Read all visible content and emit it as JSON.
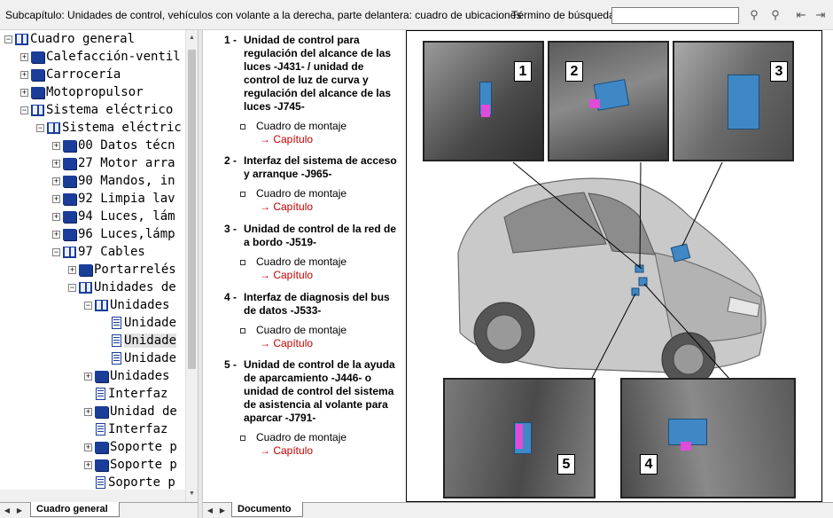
{
  "header": {
    "subchapter": "Subcapítulo: Unidades de control, vehículos con volante a la derecha, parte delantera: cuadro de ubicaciones",
    "search_label": "Término de búsqueda:",
    "search_value": ""
  },
  "tree": {
    "items": [
      {
        "label": "Cuadro general"
      },
      {
        "label": "Calefacción-ventil"
      },
      {
        "label": "Carrocería"
      },
      {
        "label": "Motopropulsor"
      },
      {
        "label": "Sistema eléctrico"
      },
      {
        "label": "Sistema eléctric"
      },
      {
        "label": "00 Datos técn"
      },
      {
        "label": "27 Motor arra"
      },
      {
        "label": "90 Mandos, in"
      },
      {
        "label": "92 Limpia lav"
      },
      {
        "label": "94 Luces, lám"
      },
      {
        "label": "96 Luces,lámp"
      },
      {
        "label": "97 Cables"
      },
      {
        "label": "Portarrelés"
      },
      {
        "label": "Unidades de"
      },
      {
        "label": "Unidades"
      },
      {
        "label": "Unidade"
      },
      {
        "label": "Unidade"
      },
      {
        "label": "Unidade"
      },
      {
        "label": "Unidades"
      },
      {
        "label": "Interfaz"
      },
      {
        "label": "Unidad de"
      },
      {
        "label": "Interfaz"
      },
      {
        "label": "Soporte p"
      },
      {
        "label": "Soporte p"
      },
      {
        "label": "Soporte p"
      }
    ]
  },
  "tabs": {
    "left": "Cuadro general",
    "right": "Documento"
  },
  "document": {
    "items": [
      {
        "num": "1 -",
        "title": "Unidad de control para regulación del alcance de las luces -J431- / unidad de control de luz de curva y regulación del alcance de las luces -J745-",
        "sub": "Cuadro de montaje",
        "link": "→ Capítulo"
      },
      {
        "num": "2 -",
        "title": "Interfaz del sistema de acceso y arranque -J965-",
        "sub": "Cuadro de montaje",
        "link": "→ Capítulo"
      },
      {
        "num": "3 -",
        "title": "Unidad de control de la red de a bordo -J519-",
        "sub": "Cuadro de montaje",
        "link": "→ Capítulo"
      },
      {
        "num": "4 -",
        "title": "Interfaz de diagnosis del bus de datos -J533-",
        "sub": "Cuadro de montaje",
        "link": "→ Capítulo"
      },
      {
        "num": "5 -",
        "title": "Unidad de control de la ayuda de aparcamiento -J446- o unidad de control del sistema de asistencia al volante para aparcar -J791-",
        "sub": "Cuadro de montaje",
        "link": "→ Capítulo"
      }
    ]
  },
  "figure": {
    "callouts": [
      "1",
      "2",
      "3",
      "4",
      "5"
    ]
  },
  "colors": {
    "link": "#c00000",
    "book": "#1b3d9a",
    "highlight": "#3f88c5",
    "magenta": "#e04bd8"
  }
}
